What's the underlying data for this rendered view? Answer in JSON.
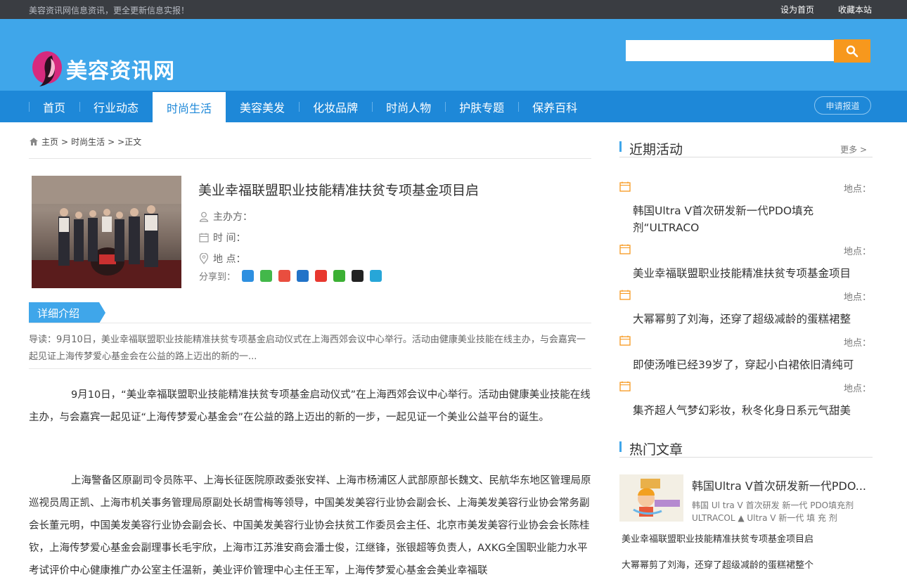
{
  "topbar": {
    "notice": "美容资讯网信息资讯，更全更新信息实报！",
    "set_home": "设为首页",
    "bookmark": "收藏本站"
  },
  "header": {
    "logo_text": "美容资讯网",
    "search": {
      "placeholder": "",
      "value": ""
    }
  },
  "nav": {
    "items": [
      "首页",
      "行业动态",
      "时尚生活",
      "美容美发",
      "化妆品牌",
      "时尚人物",
      "护肤专题",
      "保养百科"
    ],
    "active": "时尚生活",
    "apply": "申请报道"
  },
  "breadcrumb": {
    "home": "主页",
    "sep1": ">",
    "section": "时尚生活",
    "sep2": ">",
    "sep3": ">",
    "current": "正文"
  },
  "event": {
    "title": "美业幸福联盟职业技能精准扶贫专项基金项目启",
    "organizer_label": "主办方：",
    "time_label": "时 间：",
    "place_label": "地 点：",
    "share_label": "分享到："
  },
  "detail": {
    "tag": "详细介绍",
    "lead": "导读：9月10日，美业幸福联盟职业技能精准扶贫专项基金启动仪式在上海西郊会议中心举行。活动由健康美业技能在线主办，与会嘉宾一起见证上海传梦爱心基金会在公益的路上迈出的新的一...",
    "para1": "9月10日，“美业幸福联盟职业技能精准扶贫专项基金启动仪式”在上海西郊会议中心举行。活动由健康美业技能在线主办，与会嘉宾一起见证“上海传梦爱心基金会”在公益的路上迈出的新的一步，一起见证一个美业公益平台的诞生。",
    "para2": "上海警备区原副司令员陈平、上海长征医院原政委张安祥、上海市杨浦区人武部原部长魏文、民航华东地区管理局原巡视员周正凯、上海市机关事务管理局原副处长胡雪梅等领导，中国美发美容行业协会副会长、上海美发美容行业协会常务副会长董元明，中国美发美容行业协会副会长、中国美发美容行业协会扶贫工作委员会主任、北京市美发美容行业协会会长陈桂钦，上海传梦爱心基金会副理事长毛宇欣，上海市江苏淮安商会潘士俊，江继锋，张银超等负责人，AXKG全国职业能力水平考试评价中心健康推广办公室主任温新，美业评价管理中心主任王军，上海传梦爱心基金会美业幸福联"
  },
  "sidebar": {
    "activities_title": "近期活动",
    "more": "更多 >",
    "activities": [
      {
        "loc": "地点：",
        "title": "韩国Ultra V首次研发新一代PDO填充剂“ULTRACO"
      },
      {
        "loc": "地点：",
        "title": "美业幸福联盟职业技能精准扶贫专项基金项目"
      },
      {
        "loc": "地点：",
        "title": "大幂幂剪了刘海，还穿了超级减龄的蛋糕裙整"
      },
      {
        "loc": "地点：",
        "title": "即使汤唯已经39岁了，穿起小白裙依旧清纯可"
      },
      {
        "loc": "地点：",
        "title": "集齐超人气梦幻彩妆，秋冬化身日系元气甜美"
      }
    ],
    "hot_title": "热门文章",
    "hot_top": {
      "title": "韩国Ultra V首次研发新一代PDO...",
      "desc": "韩国 Ul tra V 首次研发 新一代 PDO填充剂 ULTRACOL ▲ Ultra V 新一代 填 充 剂"
    },
    "hot_list": [
      "美业幸福联盟职业技能精准扶贫专项基金项目启",
      "大幂幂剪了刘海，还穿了超级减龄的蛋糕裙整个"
    ]
  },
  "colors": {
    "header_blue": "#3fa6ea",
    "nav_blue": "#1e88d8",
    "search_button": "#f7981d"
  }
}
